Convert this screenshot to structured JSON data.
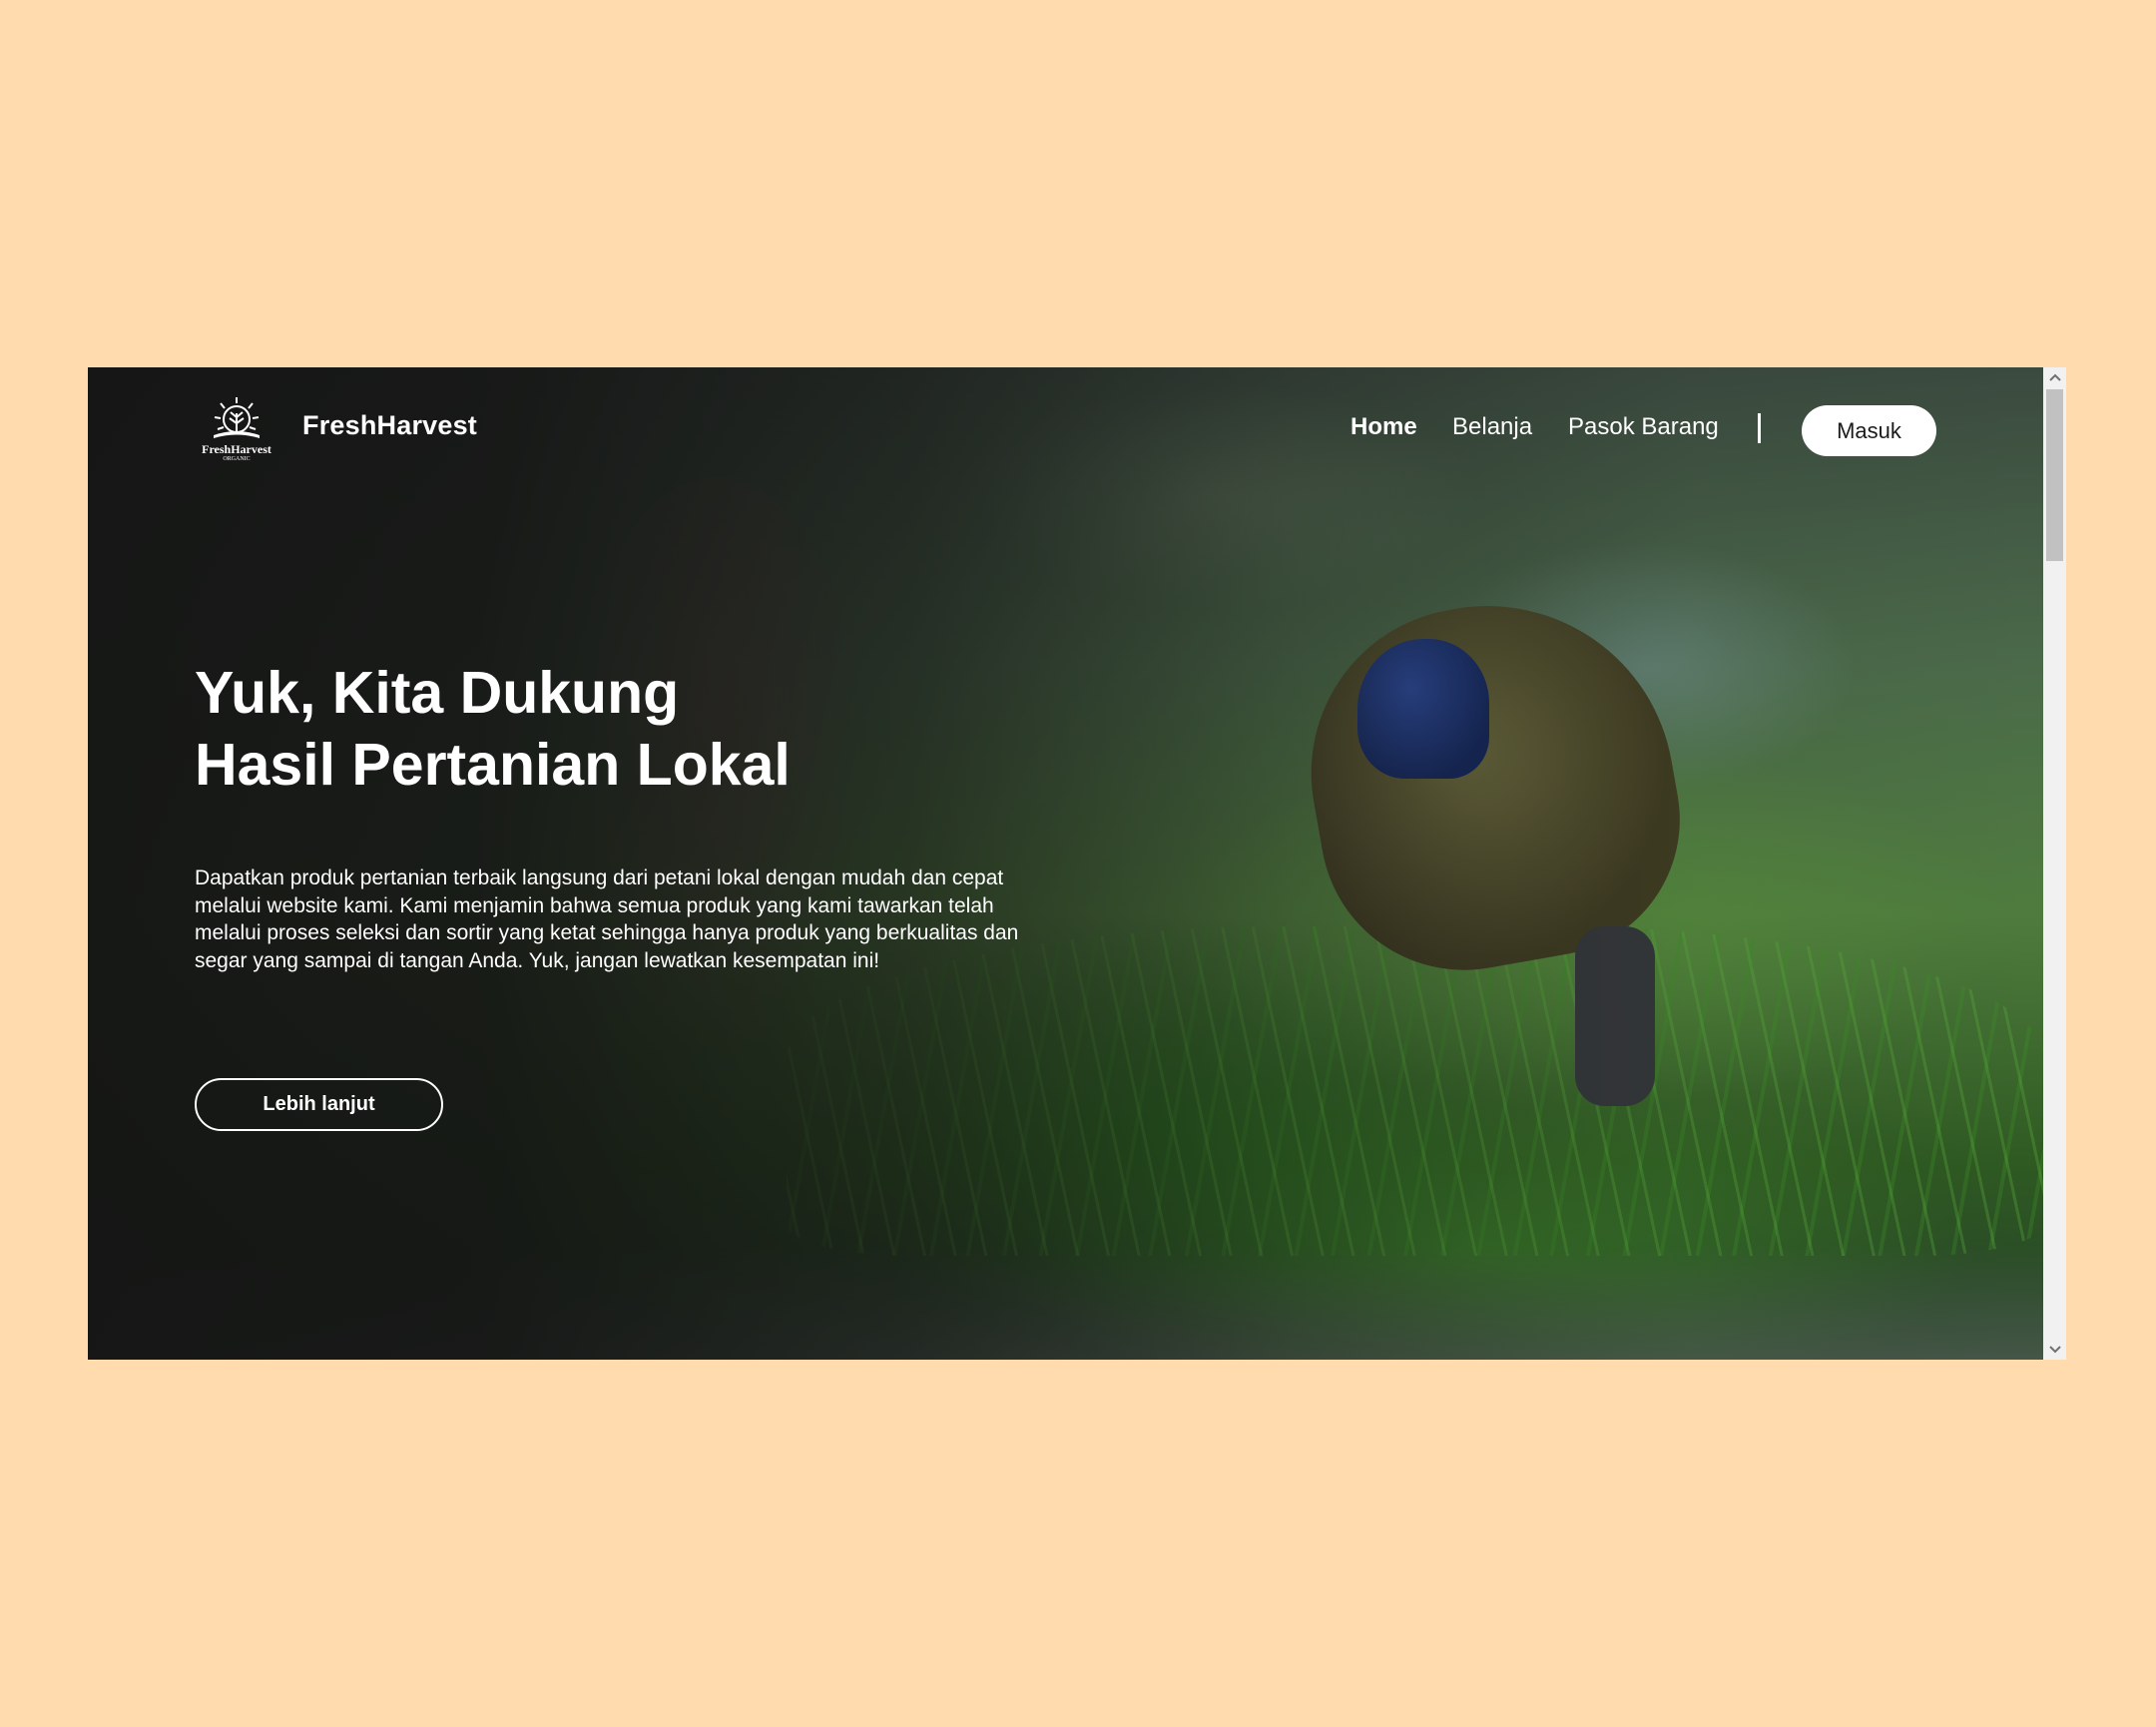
{
  "brand": {
    "logo_text": "FreshHarvest",
    "logo_subtext": "ORGANIC",
    "name": "FreshHarvest"
  },
  "nav": {
    "home": "Home",
    "belanja": "Belanja",
    "pasok": "Pasok Barang",
    "masuk": "Masuk"
  },
  "hero": {
    "title_line1": "Yuk, Kita Dukung",
    "title_line2": "Hasil Pertanian Lokal",
    "description": "Dapatkan produk pertanian terbaik langsung dari petani lokal dengan mudah dan cepat melalui website kami. Kami menjamin bahwa semua produk yang kami tawarkan telah melalui proses seleksi dan sortir yang ketat sehingga hanya produk yang berkualitas dan segar yang sampai di tangan Anda. Yuk, jangan lewatkan kesempatan ini!",
    "cta": "Lebih lanjut"
  },
  "colors": {
    "page_background": "#FFDBAE",
    "hero_overlay": "#141414",
    "button_bg": "#FFFFFF",
    "text": "#FFFFFF"
  },
  "icons": {
    "logo": "sun-wheat-logo-icon",
    "scroll_up": "chevron-up-icon",
    "scroll_down": "chevron-down-icon"
  }
}
